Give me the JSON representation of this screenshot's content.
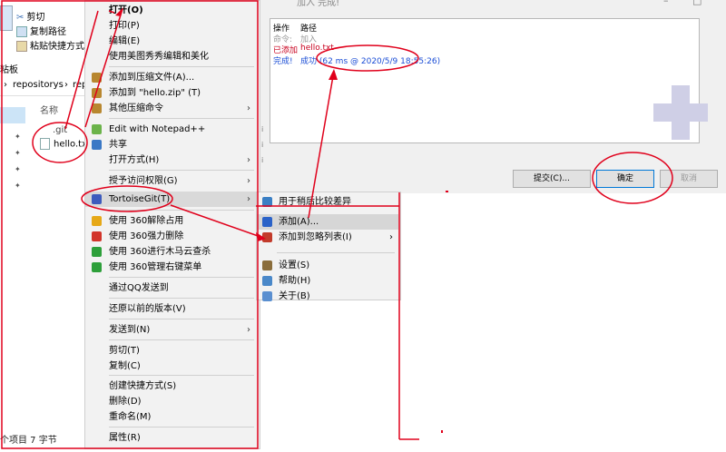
{
  "explorer": {
    "ribbon": {
      "cut_label": "剪切",
      "copy_path_label": "复制路径",
      "paste_shortcut_label": "粘贴快捷方式"
    },
    "clipboard_label": "粘板",
    "breadcrumb": [
      "repositorys",
      "rep"
    ],
    "name_header": "名称",
    "files": [
      ".git",
      "hello.txt"
    ],
    "status_text": "个项目  7 字节"
  },
  "dialog": {
    "title": "加入 完成!",
    "columns": {
      "action": "操作",
      "path": "路径"
    },
    "rows": [
      {
        "action": "命令:",
        "path": "加入",
        "color": "#9a9a9a"
      },
      {
        "action": "已添加",
        "path": "hello.txt",
        "color": "#c8001e"
      },
      {
        "action": "完成!",
        "path": "成功 (62 ms @ 2020/5/9 18:55:26)",
        "color": "#1a4dd6"
      }
    ],
    "buttons": {
      "commit": "提交(C)...",
      "ok": "确定",
      "cancel": "取消"
    },
    "side_marks": [
      "i",
      "i",
      "i"
    ]
  },
  "context_menu": {
    "items": [
      {
        "label": "打开(O)",
        "bold": true
      },
      {
        "label": "打印(P)"
      },
      {
        "label": "编辑(E)"
      },
      {
        "label": "使用美图秀秀编辑和美化"
      },
      {
        "label": "添加到压缩文件(A)...",
        "icon": "archive-icon"
      },
      {
        "label": "添加到 \"hello.zip\" (T)",
        "icon": "archive-icon"
      },
      {
        "label": "其他压缩命令",
        "icon": "archive-icon",
        "submenu": true
      },
      {
        "label": "Edit with Notepad++",
        "icon": "notepad-icon"
      },
      {
        "label": "共享",
        "icon": "share-icon"
      },
      {
        "label": "打开方式(H)",
        "submenu": true
      },
      {
        "label": "授予访问权限(G)",
        "submenu": true
      },
      {
        "label": "TortoiseGit(T)",
        "icon": "tortoisegit-icon",
        "submenu": true,
        "highlighted": true
      },
      {
        "label": "使用 360解除占用",
        "icon": "folder-360-icon"
      },
      {
        "label": "使用 360强力删除",
        "icon": "delete-360-icon"
      },
      {
        "label": "使用 360进行木马云查杀",
        "icon": "shield-360-icon"
      },
      {
        "label": "使用 360管理右键菜单",
        "icon": "shield-360-icon"
      },
      {
        "label": "通过QQ发送到"
      },
      {
        "label": "还原以前的版本(V)"
      },
      {
        "label": "发送到(N)",
        "submenu": true
      },
      {
        "label": "剪切(T)"
      },
      {
        "label": "复制(C)"
      },
      {
        "label": "创建快捷方式(S)"
      },
      {
        "label": "删除(D)"
      },
      {
        "label": "重命名(M)"
      },
      {
        "label": "属性(R)"
      }
    ]
  },
  "tortoisegit_submenu": {
    "items": [
      {
        "label": "用于稍后比较差异",
        "icon": "search-icon"
      },
      {
        "label": "添加(A)...",
        "icon": "add-icon",
        "highlighted": true
      },
      {
        "label": "添加到忽略列表(I)",
        "icon": "ignore-icon",
        "submenu": true
      },
      {
        "label": "设置(S)",
        "icon": "wrench-icon"
      },
      {
        "label": "帮助(H)",
        "icon": "help-icon"
      },
      {
        "label": "关于(B)",
        "icon": "info-icon"
      }
    ]
  },
  "colors": {
    "annotation_red": "#e0001b",
    "menu_bg": "#f2f2f2",
    "highlight": "#d9d9d9",
    "link_blue": "#1a4dd6"
  }
}
